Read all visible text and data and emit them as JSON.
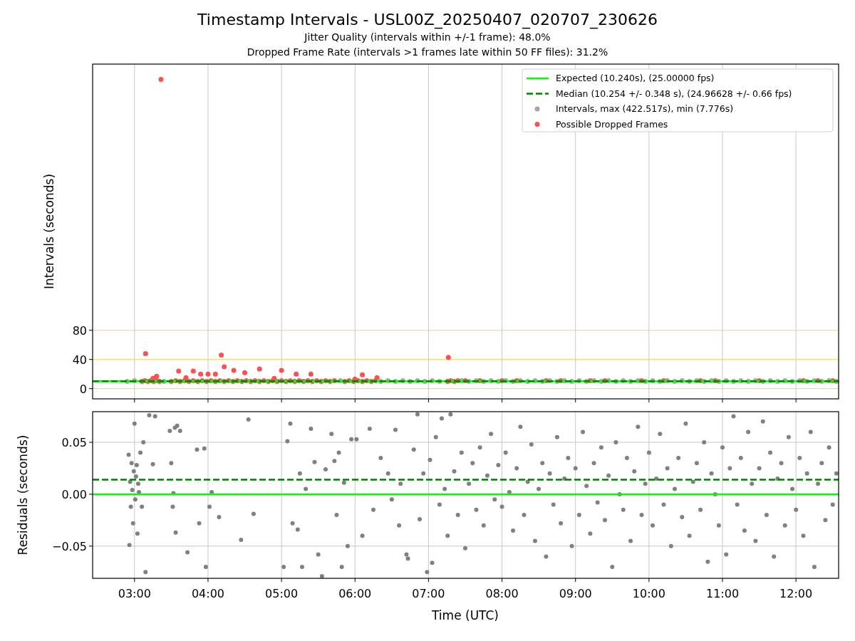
{
  "figure": {
    "title": "Timestamp Intervals - USL00Z_20250407_020707_230626",
    "subtitles": [
      "Jitter Quality (intervals within +/-1 frame): 48.0%",
      "Dropped Frame Rate (intervals >1 frames late within 50 FF files): 31.2%"
    ]
  },
  "charts": [
    {
      "chart_data": {
        "type": "scatter",
        "ylabel": "Intervals (seconds)",
        "xlim": [
          2.43,
          12.58
        ],
        "ylim": [
          -14,
          445
        ],
        "yticks": [
          {
            "value": 0,
            "label": "0"
          },
          {
            "value": 40,
            "label": "40"
          },
          {
            "value": 80,
            "label": "80"
          }
        ],
        "grid": true,
        "legend": true,
        "series": [
          {
            "name": "Intervals, max (422.517s), min (7.776s)",
            "type": "scatter",
            "color": "#a6a6a6",
            "x": [
              2.9,
              3.0,
              3.4,
              5.8,
              6.35,
              6.45,
              6.55,
              6.65,
              6.75,
              6.85,
              6.95,
              7.05,
              7.15,
              7.45,
              7.55,
              7.65,
              7.75,
              7.85,
              7.95,
              8.05,
              8.15,
              8.25,
              8.35,
              8.45,
              8.55,
              8.65,
              8.75,
              8.85,
              8.95,
              9.05,
              9.15,
              9.25,
              9.35,
              9.45,
              9.55,
              9.65,
              9.75,
              9.85,
              9.95,
              10.05,
              10.15,
              10.25,
              10.35,
              10.45,
              10.55,
              10.65,
              10.75,
              10.85,
              10.95,
              11.05,
              11.15,
              11.25,
              11.35,
              11.45,
              11.55,
              11.65,
              11.75,
              11.85,
              11.95,
              12.05,
              12.15,
              12.25,
              12.35,
              12.45,
              12.55
            ],
            "values": [
              10,
              11,
              10,
              11,
              10,
              11,
              10,
              11,
              10,
              11,
              10,
              11,
              10,
              11,
              10,
              11,
              10,
              11,
              10,
              11,
              10,
              11,
              10,
              11,
              10,
              11,
              10,
              11,
              10,
              11,
              10,
              11,
              10,
              11,
              10,
              11,
              10,
              11,
              10,
              11,
              10,
              11,
              10,
              11,
              10,
              11,
              10,
              11,
              10,
              11,
              10,
              11,
              10,
              11,
              10,
              11,
              10,
              11,
              10,
              11,
              10,
              11,
              10,
              11,
              10
            ]
          },
          {
            "name": "Possible Dropped Frames",
            "type": "scatter",
            "color": "#ff5050",
            "x": [
              3.1,
              3.14,
              3.18,
              3.22,
              3.26,
              3.3,
              3.34,
              3.5,
              3.56,
              3.62,
              3.68,
              3.74,
              3.8,
              3.86,
              3.92,
              3.98,
              4.04,
              4.1,
              4.16,
              4.22,
              4.28,
              4.34,
              4.4,
              4.46,
              4.52,
              4.58,
              4.64,
              4.7,
              4.76,
              4.82,
              4.88,
              4.94,
              5.0,
              5.06,
              5.12,
              5.18,
              5.24,
              5.3,
              5.36,
              5.42,
              5.48,
              5.54,
              5.6,
              5.66,
              5.72,
              5.86,
              5.92,
              5.98,
              6.04,
              6.1,
              6.16,
              6.22,
              6.28,
              7.26,
              7.3,
              7.35,
              7.4,
              3.15,
              3.36,
              3.25,
              3.3,
              3.6,
              3.7,
              3.8,
              3.9,
              4.0,
              4.1,
              4.18,
              4.22,
              4.35,
              4.5,
              4.7,
              4.9,
              5.0,
              5.2,
              5.4,
              6.0,
              6.1,
              6.3,
              7.27,
              7.5,
              7.7,
              8.0,
              8.2,
              8.6,
              8.8,
              9.2,
              9.4,
              9.9,
              10.2,
              10.7,
              10.9,
              11.5,
              12.1,
              12.3,
              12.5
            ],
            "values": [
              10,
              11,
              10,
              11,
              10,
              11,
              10,
              10,
              11,
              10,
              11,
              10,
              11,
              10,
              11,
              10,
              11,
              10,
              11,
              10,
              11,
              10,
              11,
              10,
              11,
              10,
              11,
              10,
              11,
              10,
              11,
              10,
              11,
              10,
              11,
              10,
              11,
              10,
              11,
              10,
              11,
              10,
              11,
              10,
              11,
              10,
              11,
              10,
              11,
              10,
              11,
              10,
              11,
              10,
              11,
              10,
              11,
              48,
              424,
              14,
              17,
              24,
              15,
              24,
              20,
              20,
              20,
              46,
              30,
              25,
              22,
              27,
              14,
              25,
              20,
              20,
              13,
              19,
              15,
              43,
              11,
              11,
              11,
              11,
              11,
              11,
              11,
              11,
              11,
              11,
              11,
              11,
              11,
              11,
              11,
              11
            ]
          },
          {
            "name": "Expected (10.240s), (25.00000 fps)",
            "type": "line",
            "line_style": "solid",
            "color": "#00ff00",
            "x": [
              2.43,
              12.58
            ],
            "values": [
              10.24,
              10.24
            ]
          },
          {
            "name": "Median (10.254 +/- 0.348 s), (24.96628 +/- 0.66 fps)",
            "type": "line",
            "line_style": "dashed",
            "color": "#008000",
            "x": [
              2.43,
              12.58
            ],
            "values": [
              10.25,
              10.25
            ]
          }
        ]
      }
    },
    {
      "chart_data": {
        "type": "scatter",
        "xlabel": "Time (UTC)",
        "ylabel": "Residuals (seconds)",
        "xlim": [
          2.43,
          12.58
        ],
        "ylim": [
          -0.081,
          0.0795
        ],
        "xticks": [
          {
            "value": 3,
            "label": "03:00"
          },
          {
            "value": 4,
            "label": "04:00"
          },
          {
            "value": 5,
            "label": "05:00"
          },
          {
            "value": 6,
            "label": "06:00"
          },
          {
            "value": 7,
            "label": "07:00"
          },
          {
            "value": 8,
            "label": "08:00"
          },
          {
            "value": 9,
            "label": "09:00"
          },
          {
            "value": 10,
            "label": "10:00"
          },
          {
            "value": 11,
            "label": "11:00"
          },
          {
            "value": 12,
            "label": "12:00"
          }
        ],
        "yticks": [
          {
            "value": 0.05,
            "label": "0.05"
          },
          {
            "value": 0,
            "label": "0.00"
          },
          {
            "value": -0.05,
            "label": "−0.05"
          }
        ],
        "grid": true,
        "series": [
          {
            "type": "scatter",
            "color": "#808080",
            "x": [
              2.92,
              2.93,
              2.94,
              2.95,
              2.96,
              2.97,
              2.98,
              2.99,
              3.0,
              3.01,
              3.02,
              3.03,
              3.04,
              3.05,
              3.06,
              3.08,
              3.1,
              3.12,
              3.15,
              3.2,
              3.25,
              3.28,
              3.48,
              3.5,
              3.52,
              3.53,
              3.55,
              3.56,
              3.58,
              3.62,
              3.72,
              3.85,
              3.88,
              3.95,
              3.97,
              4.02,
              4.05,
              4.15,
              4.45,
              4.55,
              4.62,
              5.03,
              5.08,
              5.12,
              5.15,
              5.22,
              5.25,
              5.28,
              5.33,
              5.4,
              5.45,
              5.5,
              5.55,
              5.6,
              5.68,
              5.72,
              5.75,
              5.78,
              5.82,
              5.85,
              5.9,
              5.95,
              6.02,
              6.1,
              6.2,
              6.25,
              6.35,
              6.45,
              6.5,
              6.55,
              6.6,
              6.62,
              6.7,
              6.72,
              6.8,
              6.85,
              6.88,
              6.93,
              6.98,
              7.02,
              7.05,
              7.1,
              7.15,
              7.18,
              7.22,
              7.26,
              7.3,
              7.35,
              7.4,
              7.45,
              7.5,
              7.55,
              7.6,
              7.65,
              7.7,
              7.75,
              7.8,
              7.85,
              7.9,
              7.95,
              8.0,
              8.05,
              8.1,
              8.15,
              8.2,
              8.25,
              8.3,
              8.35,
              8.4,
              8.45,
              8.5,
              8.55,
              8.6,
              8.65,
              8.7,
              8.75,
              8.8,
              8.85,
              8.9,
              8.95,
              9.0,
              9.05,
              9.1,
              9.15,
              9.2,
              9.25,
              9.3,
              9.35,
              9.4,
              9.45,
              9.5,
              9.55,
              9.6,
              9.65,
              9.7,
              9.75,
              9.8,
              9.85,
              9.9,
              9.95,
              10.0,
              10.05,
              10.1,
              10.15,
              10.2,
              10.25,
              10.3,
              10.35,
              10.4,
              10.45,
              10.5,
              10.55,
              10.6,
              10.65,
              10.7,
              10.75,
              10.8,
              10.85,
              10.9,
              10.95,
              11.0,
              11.05,
              11.1,
              11.15,
              11.2,
              11.25,
              11.3,
              11.35,
              11.4,
              11.45,
              11.5,
              11.55,
              11.6,
              11.65,
              11.7,
              11.75,
              11.8,
              11.85,
              11.9,
              11.95,
              12.0,
              12.05,
              12.1,
              12.15,
              12.2,
              12.25,
              12.3,
              12.35,
              12.4,
              12.45,
              12.5,
              12.55
            ],
            "values": [
              0.038,
              -0.049,
              0.012,
              -0.012,
              0.03,
              0.004,
              -0.028,
              0.022,
              0.068,
              -0.005,
              0.017,
              0.028,
              -0.038,
              0.01,
              0.002,
              0.04,
              -0.012,
              0.05,
              -0.075,
              0.076,
              0.029,
              0.075,
              0.061,
              0.03,
              -0.012,
              0.001,
              0.064,
              -0.037,
              0.066,
              0.061,
              -0.056,
              0.043,
              -0.028,
              0.044,
              -0.07,
              -0.012,
              0.002,
              -0.022,
              -0.044,
              0.072,
              -0.019,
              -0.07,
              0.051,
              0.068,
              -0.028,
              -0.034,
              0.02,
              -0.07,
              0.005,
              0.063,
              0.031,
              -0.058,
              -0.079,
              0.024,
              0.058,
              0.032,
              -0.02,
              0.04,
              -0.07,
              0.011,
              -0.05,
              0.053,
              0.053,
              -0.04,
              0.063,
              -0.015,
              0.035,
              0.02,
              -0.005,
              0.062,
              -0.03,
              0.01,
              -0.058,
              -0.062,
              0.043,
              0.077,
              -0.024,
              0.02,
              -0.075,
              0.033,
              -0.066,
              0.055,
              -0.01,
              0.073,
              0.005,
              -0.04,
              0.077,
              0.022,
              -0.02,
              0.04,
              -0.052,
              0.01,
              0.03,
              -0.015,
              0.045,
              -0.03,
              0.018,
              0.058,
              -0.005,
              0.028,
              -0.012,
              0.04,
              0.002,
              -0.035,
              0.025,
              0.065,
              -0.02,
              0.012,
              0.048,
              -0.045,
              0.005,
              0.03,
              -0.06,
              0.02,
              -0.01,
              0.055,
              -0.028,
              0.015,
              0.035,
              -0.05,
              0.025,
              -0.02,
              0.06,
              0.008,
              -0.038,
              0.03,
              -0.008,
              0.045,
              -0.025,
              0.018,
              -0.07,
              0.05,
              0.0,
              -0.015,
              0.035,
              -0.045,
              0.022,
              0.065,
              -0.02,
              0.01,
              0.04,
              -0.03,
              0.015,
              0.058,
              -0.01,
              0.025,
              -0.05,
              0.005,
              0.035,
              -0.022,
              0.068,
              -0.04,
              0.012,
              0.03,
              -0.015,
              0.05,
              -0.065,
              0.02,
              0.0,
              -0.03,
              0.045,
              -0.058,
              0.025,
              0.075,
              -0.01,
              0.035,
              -0.035,
              0.06,
              0.01,
              -0.045,
              0.025,
              0.07,
              -0.02,
              0.04,
              -0.06,
              0.015,
              0.03,
              -0.03,
              0.055,
              0.005,
              -0.015,
              0.035,
              -0.04,
              0.02,
              0.06,
              -0.07,
              0.01,
              0.03,
              -0.025,
              0.045,
              -0.01,
              0.02
            ]
          },
          {
            "type": "line",
            "line_style": "solid",
            "color": "#00ff00",
            "x": [
              2.43,
              12.58
            ],
            "values": [
              0,
              0
            ]
          },
          {
            "type": "line",
            "line_style": "dashed",
            "color": "#008000",
            "x": [
              2.43,
              12.58
            ],
            "values": [
              0.014,
              0.014
            ]
          }
        ]
      }
    }
  ]
}
